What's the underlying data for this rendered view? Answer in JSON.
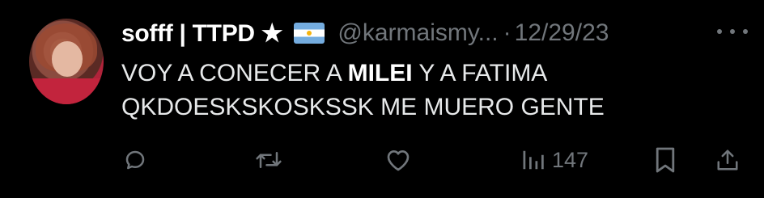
{
  "tweet": {
    "display_name": "sofff | TTPD ★",
    "handle": "@karmaismy...",
    "separator": "·",
    "date": "12/29/23",
    "text_before": "VOY A CONECER A ",
    "text_bold": "MILEI",
    "text_after": " Y A FATIMA QKDOESKSKOSKSSK ME MUERO GENTE",
    "views": "147"
  },
  "icons": {
    "reply": "reply-icon",
    "retweet": "retweet-icon",
    "like": "heart-icon",
    "views": "views-bar-chart-icon",
    "bookmark": "bookmark-icon",
    "share": "share-icon",
    "more": "more-horizontal-icon",
    "flag": "argentina-flag-icon"
  },
  "colors": {
    "background": "#000000",
    "text": "#e7e9ea",
    "muted": "#71767b"
  }
}
